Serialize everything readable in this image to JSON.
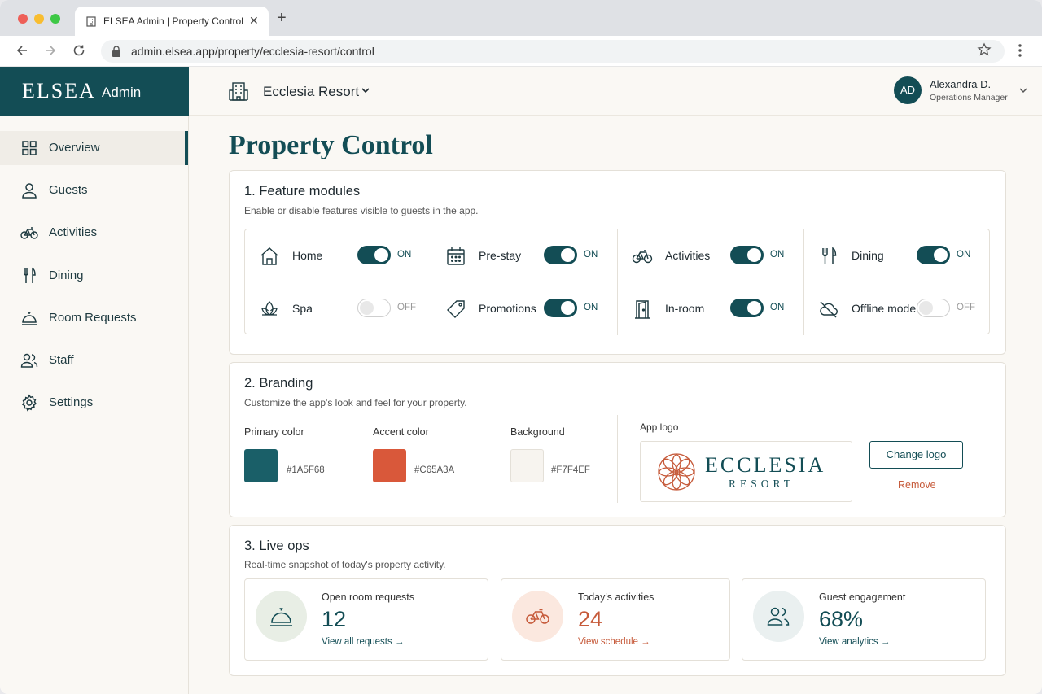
{
  "browser": {
    "tab_title": "ELSEA Admin | Property Control",
    "tab_close": "✕",
    "new_tab": "+",
    "url": "admin.elsea.app/property/ecclesia-resort/control"
  },
  "brand": {
    "name": "ELSEA",
    "suffix": "Admin"
  },
  "sidebar": {
    "items": [
      {
        "label": "Overview",
        "icon": "grid-icon",
        "active": true
      },
      {
        "label": "Guests",
        "icon": "person-icon"
      },
      {
        "label": "Activities",
        "icon": "bicycle-icon"
      },
      {
        "label": "Dining",
        "icon": "fork-knife-icon"
      },
      {
        "label": "Room Requests",
        "icon": "cloche-icon"
      },
      {
        "label": "Staff",
        "icon": "people-icon"
      },
      {
        "label": "Settings",
        "icon": "gear-icon"
      }
    ]
  },
  "header": {
    "property": "Ecclesia Resort",
    "user": {
      "initials": "AD",
      "name": "Alexandra D.",
      "role": "Operations Manager"
    }
  },
  "page": {
    "title": "Property Control"
  },
  "features": {
    "title": "1. Feature modules",
    "subtitle": "Enable or disable features visible to guests in the app.",
    "items": [
      {
        "label": "Home",
        "state": "ON",
        "icon": "home-icon"
      },
      {
        "label": "Pre-stay",
        "state": "ON",
        "icon": "calendar-icon"
      },
      {
        "label": "Activities",
        "state": "ON",
        "icon": "bicycle-icon"
      },
      {
        "label": "Dining",
        "state": "ON",
        "icon": "fork-knife-icon"
      },
      {
        "label": "Spa",
        "state": "OFF",
        "icon": "lotus-icon"
      },
      {
        "label": "Promotions",
        "state": "ON",
        "icon": "tag-icon"
      },
      {
        "label": "In-room",
        "state": "ON",
        "icon": "door-icon"
      },
      {
        "label": "Offline mode",
        "state": "OFF",
        "icon": "cloud-off-icon"
      }
    ]
  },
  "branding": {
    "title": "2. Branding",
    "subtitle": "Customize the app's look and feel for your property.",
    "colors": [
      {
        "label": "Primary color",
        "hex": "#1A5F68",
        "swatch": "#1a5f68"
      },
      {
        "label": "Accent color",
        "hex": "#C65A3A",
        "swatch": "#d9583a"
      },
      {
        "label": "Background",
        "hex": "#F7F4EF",
        "swatch": "#f7f4ef"
      }
    ],
    "logo_label": "App logo",
    "logo_word1": "ECCLESIA",
    "logo_word2": "RESORT",
    "change_logo": "Change logo",
    "remove": "Remove"
  },
  "liveops": {
    "title": "3. Live ops",
    "subtitle": "Real-time snapshot of today's property activity.",
    "stats": [
      {
        "label": "Open room requests",
        "value": "12",
        "link": "View all requests",
        "icon": "cloche-icon"
      },
      {
        "label": "Today's activities",
        "value": "24",
        "link": "View schedule",
        "icon": "bicycle-icon"
      },
      {
        "label": "Guest engagement",
        "value": "68%",
        "link": "View analytics",
        "icon": "people-icon"
      }
    ]
  },
  "colors": {
    "primary": "#134d55",
    "accent": "#c65a3a",
    "background": "#faf8f4"
  }
}
